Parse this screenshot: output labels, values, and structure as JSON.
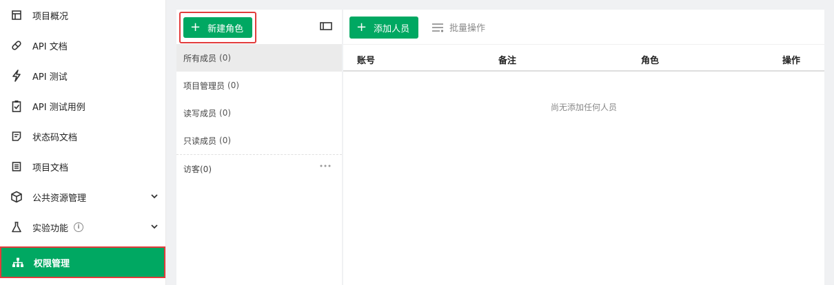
{
  "sidebar": {
    "items": [
      {
        "label": "项目概况",
        "icon": "overview-icon"
      },
      {
        "label": "API 文档",
        "icon": "link-icon"
      },
      {
        "label": "API 测试",
        "icon": "lightning-icon"
      },
      {
        "label": "API 测试用例",
        "icon": "clipboard-check-icon"
      },
      {
        "label": "状态码文档",
        "icon": "document-icon"
      },
      {
        "label": "项目文档",
        "icon": "list-document-icon"
      },
      {
        "label": "公共资源管理",
        "icon": "cube-icon"
      },
      {
        "label": "实验功能",
        "icon": "flask-icon",
        "info": "i"
      },
      {
        "label": "权限管理",
        "icon": "org-chart-icon"
      }
    ]
  },
  "roles": {
    "new_role_label": "新建角色",
    "items": [
      {
        "label": "所有成员",
        "count": "(0)"
      },
      {
        "label": "项目管理员",
        "count": "(0)"
      },
      {
        "label": "读写成员",
        "count": "(0)"
      },
      {
        "label": "只读成员",
        "count": "(0)"
      },
      {
        "label": "访客(0)"
      }
    ]
  },
  "members": {
    "add_label": "添加人员",
    "batch_label": "批量操作",
    "columns": [
      "账号",
      "备注",
      "角色",
      "操作"
    ],
    "empty_text": "尚无添加任何人员"
  },
  "colors": {
    "accent": "#00a862",
    "highlight_border": "#e23b3b"
  }
}
